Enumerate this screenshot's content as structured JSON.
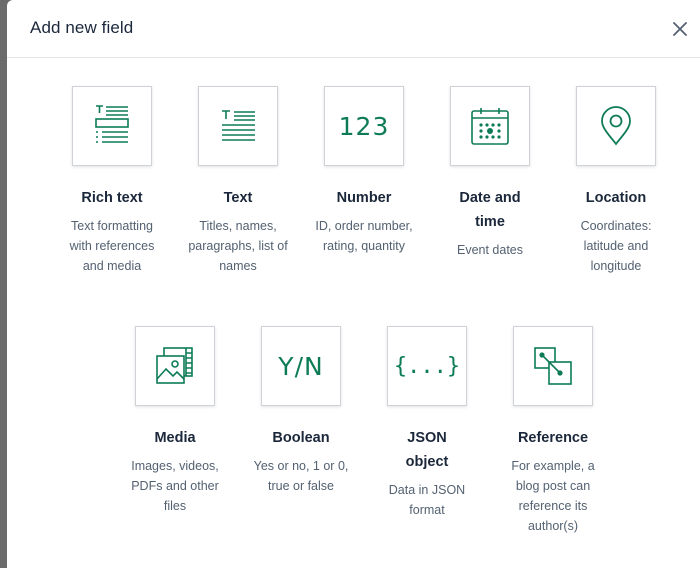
{
  "modal": {
    "title": "Add new field",
    "close_icon": "close-icon"
  },
  "fields": {
    "rich_text": {
      "icon": "rich-text-icon",
      "title": "Rich text",
      "description": "Text formatting with references and media"
    },
    "text": {
      "icon": "text-icon",
      "title": "Text",
      "description": "Titles, names, paragraphs, list of names"
    },
    "number": {
      "icon_text": "123",
      "title": "Number",
      "description": "ID, order number, rating, quantity"
    },
    "date_time": {
      "icon": "calendar-icon",
      "title": "Date and time",
      "description": "Event dates"
    },
    "location": {
      "icon": "location-pin-icon",
      "title": "Location",
      "description": "Coordinates: latitude and longitude"
    },
    "media": {
      "icon": "media-icon",
      "title": "Media",
      "description": "Images, videos, PDFs and other files"
    },
    "boolean": {
      "icon_text": "Y/N",
      "title": "Boolean",
      "description": "Yes or no, 1 or 0, true or false"
    },
    "json": {
      "icon_text": "{...}",
      "title": "JSON object",
      "description": "Data in JSON format"
    },
    "reference": {
      "icon": "reference-icon",
      "title": "Reference",
      "description": "For example, a blog post can reference its author(s)"
    }
  },
  "colors": {
    "accent": "#0d7c56",
    "title": "#1b273a",
    "description": "#536171"
  }
}
